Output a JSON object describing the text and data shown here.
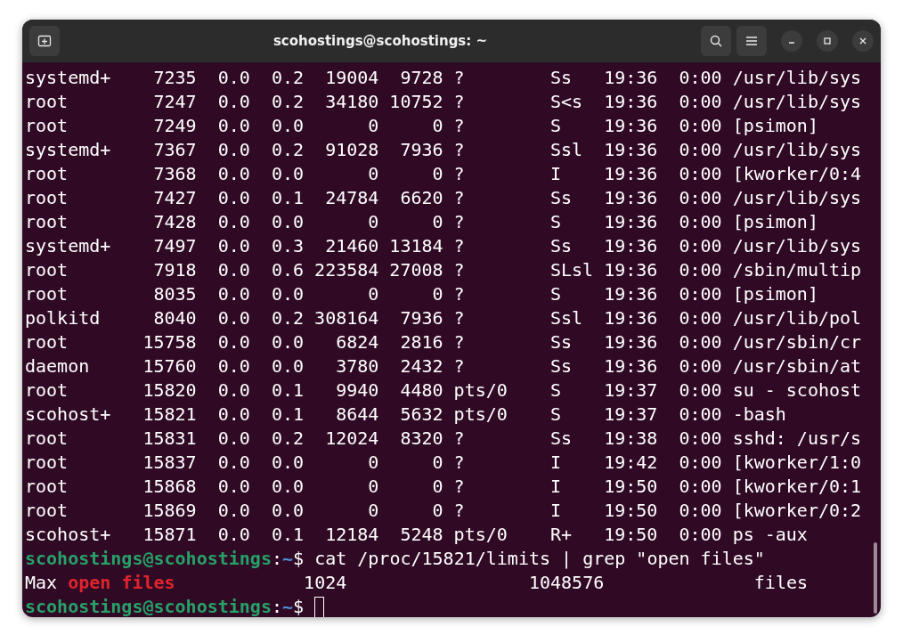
{
  "window": {
    "title": "scohostings@scohostings: ~"
  },
  "processes": [
    {
      "user": "systemd+",
      "pid": "7235",
      "cpu": "0.0",
      "mem": "0.2",
      "vsz": "19004",
      "rss": "9728",
      "tty": "?",
      "stat": "Ss",
      "start": "19:36",
      "time": "0:00",
      "command": "/usr/lib/sys"
    },
    {
      "user": "root",
      "pid": "7247",
      "cpu": "0.0",
      "mem": "0.2",
      "vsz": "34180",
      "rss": "10752",
      "tty": "?",
      "stat": "S<s",
      "start": "19:36",
      "time": "0:00",
      "command": "/usr/lib/sys"
    },
    {
      "user": "root",
      "pid": "7249",
      "cpu": "0.0",
      "mem": "0.0",
      "vsz": "0",
      "rss": "0",
      "tty": "?",
      "stat": "S",
      "start": "19:36",
      "time": "0:00",
      "command": "[psimon]"
    },
    {
      "user": "systemd+",
      "pid": "7367",
      "cpu": "0.0",
      "mem": "0.2",
      "vsz": "91028",
      "rss": "7936",
      "tty": "?",
      "stat": "Ssl",
      "start": "19:36",
      "time": "0:00",
      "command": "/usr/lib/sys"
    },
    {
      "user": "root",
      "pid": "7368",
      "cpu": "0.0",
      "mem": "0.0",
      "vsz": "0",
      "rss": "0",
      "tty": "?",
      "stat": "I",
      "start": "19:36",
      "time": "0:00",
      "command": "[kworker/0:4"
    },
    {
      "user": "root",
      "pid": "7427",
      "cpu": "0.0",
      "mem": "0.1",
      "vsz": "24784",
      "rss": "6620",
      "tty": "?",
      "stat": "Ss",
      "start": "19:36",
      "time": "0:00",
      "command": "/usr/lib/sys"
    },
    {
      "user": "root",
      "pid": "7428",
      "cpu": "0.0",
      "mem": "0.0",
      "vsz": "0",
      "rss": "0",
      "tty": "?",
      "stat": "S",
      "start": "19:36",
      "time": "0:00",
      "command": "[psimon]"
    },
    {
      "user": "systemd+",
      "pid": "7497",
      "cpu": "0.0",
      "mem": "0.3",
      "vsz": "21460",
      "rss": "13184",
      "tty": "?",
      "stat": "Ss",
      "start": "19:36",
      "time": "0:00",
      "command": "/usr/lib/sys"
    },
    {
      "user": "root",
      "pid": "7918",
      "cpu": "0.0",
      "mem": "0.6",
      "vsz": "223584",
      "rss": "27008",
      "tty": "?",
      "stat": "SLsl",
      "start": "19:36",
      "time": "0:00",
      "command": "/sbin/multip"
    },
    {
      "user": "root",
      "pid": "8035",
      "cpu": "0.0",
      "mem": "0.0",
      "vsz": "0",
      "rss": "0",
      "tty": "?",
      "stat": "S",
      "start": "19:36",
      "time": "0:00",
      "command": "[psimon]"
    },
    {
      "user": "polkitd",
      "pid": "8040",
      "cpu": "0.0",
      "mem": "0.2",
      "vsz": "308164",
      "rss": "7936",
      "tty": "?",
      "stat": "Ssl",
      "start": "19:36",
      "time": "0:00",
      "command": "/usr/lib/pol"
    },
    {
      "user": "root",
      "pid": "15758",
      "cpu": "0.0",
      "mem": "0.0",
      "vsz": "6824",
      "rss": "2816",
      "tty": "?",
      "stat": "Ss",
      "start": "19:36",
      "time": "0:00",
      "command": "/usr/sbin/cr"
    },
    {
      "user": "daemon",
      "pid": "15760",
      "cpu": "0.0",
      "mem": "0.0",
      "vsz": "3780",
      "rss": "2432",
      "tty": "?",
      "stat": "Ss",
      "start": "19:36",
      "time": "0:00",
      "command": "/usr/sbin/at"
    },
    {
      "user": "root",
      "pid": "15820",
      "cpu": "0.0",
      "mem": "0.1",
      "vsz": "9940",
      "rss": "4480",
      "tty": "pts/0",
      "stat": "S",
      "start": "19:37",
      "time": "0:00",
      "command": "su - scohost"
    },
    {
      "user": "scohost+",
      "pid": "15821",
      "cpu": "0.0",
      "mem": "0.1",
      "vsz": "8644",
      "rss": "5632",
      "tty": "pts/0",
      "stat": "S",
      "start": "19:37",
      "time": "0:00",
      "command": "-bash"
    },
    {
      "user": "root",
      "pid": "15831",
      "cpu": "0.0",
      "mem": "0.2",
      "vsz": "12024",
      "rss": "8320",
      "tty": "?",
      "stat": "Ss",
      "start": "19:38",
      "time": "0:00",
      "command": "sshd: /usr/s"
    },
    {
      "user": "root",
      "pid": "15837",
      "cpu": "0.0",
      "mem": "0.0",
      "vsz": "0",
      "rss": "0",
      "tty": "?",
      "stat": "I",
      "start": "19:42",
      "time": "0:00",
      "command": "[kworker/1:0"
    },
    {
      "user": "root",
      "pid": "15868",
      "cpu": "0.0",
      "mem": "0.0",
      "vsz": "0",
      "rss": "0",
      "tty": "?",
      "stat": "I",
      "start": "19:50",
      "time": "0:00",
      "command": "[kworker/0:1"
    },
    {
      "user": "root",
      "pid": "15869",
      "cpu": "0.0",
      "mem": "0.0",
      "vsz": "0",
      "rss": "0",
      "tty": "?",
      "stat": "I",
      "start": "19:50",
      "time": "0:00",
      "command": "[kworker/0:2"
    },
    {
      "user": "scohost+",
      "pid": "15871",
      "cpu": "0.0",
      "mem": "0.1",
      "vsz": "12184",
      "rss": "5248",
      "tty": "pts/0",
      "stat": "R+",
      "start": "19:50",
      "time": "0:00",
      "command": "ps -aux"
    }
  ],
  "session": [
    {
      "kind": "prompt",
      "user_host": "scohostings@scohostings",
      "separator": ":",
      "path": "~",
      "symbol": "$",
      "command": "cat /proc/15821/limits | grep \"open files\""
    },
    {
      "kind": "output",
      "segments": [
        {
          "text": "Max ",
          "match": false
        },
        {
          "text": "open files",
          "match": true
        },
        {
          "text": "            1024                 1048576              files",
          "match": false
        }
      ]
    },
    {
      "kind": "prompt",
      "user_host": "scohostings@scohostings",
      "separator": ":",
      "path": "~",
      "symbol": "$",
      "cursor": true
    }
  ]
}
